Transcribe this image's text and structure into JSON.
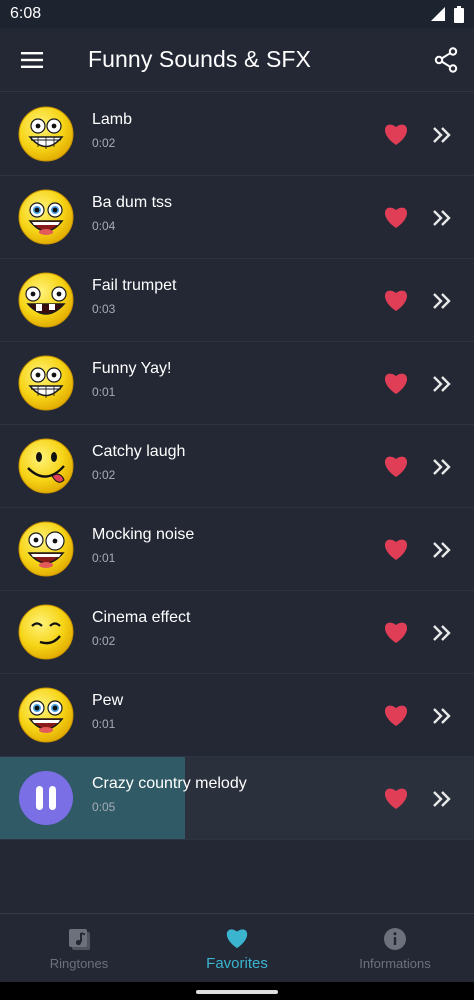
{
  "status_bar": {
    "time": "6:08"
  },
  "app_bar": {
    "title": "Funny Sounds & SFX"
  },
  "sounds": [
    {
      "title": "Lamb",
      "duration": "0:02",
      "face": "grin"
    },
    {
      "title": "Ba dum tss",
      "duration": "0:04",
      "face": "laugh-blue"
    },
    {
      "title": "Fail trumpet",
      "duration": "0:03",
      "face": "derp"
    },
    {
      "title": "Funny Yay!",
      "duration": "0:01",
      "face": "grin"
    },
    {
      "title": "Catchy laugh",
      "duration": "0:02",
      "face": "tongue"
    },
    {
      "title": "Mocking noise",
      "duration": "0:01",
      "face": "crazy"
    },
    {
      "title": "Cinema effect",
      "duration": "0:02",
      "face": "smirk"
    },
    {
      "title": "Pew",
      "duration": "0:01",
      "face": "laugh-blue"
    },
    {
      "title": "Crazy country melody",
      "duration": "0:05",
      "face": "pause",
      "playing": true,
      "progress": 0.39
    }
  ],
  "bottom_nav": {
    "items": [
      {
        "label": "Ringtones",
        "icon": "music-note-icon"
      },
      {
        "label": "Favorites",
        "icon": "heart-icon",
        "active": true
      },
      {
        "label": "Informations",
        "icon": "info-icon"
      }
    ]
  },
  "colors": {
    "background": "#232834",
    "accent": "#3bb5cf",
    "heart": "#e03e57",
    "pause_button": "#7b6fe6",
    "progress": "#2f5a66"
  }
}
